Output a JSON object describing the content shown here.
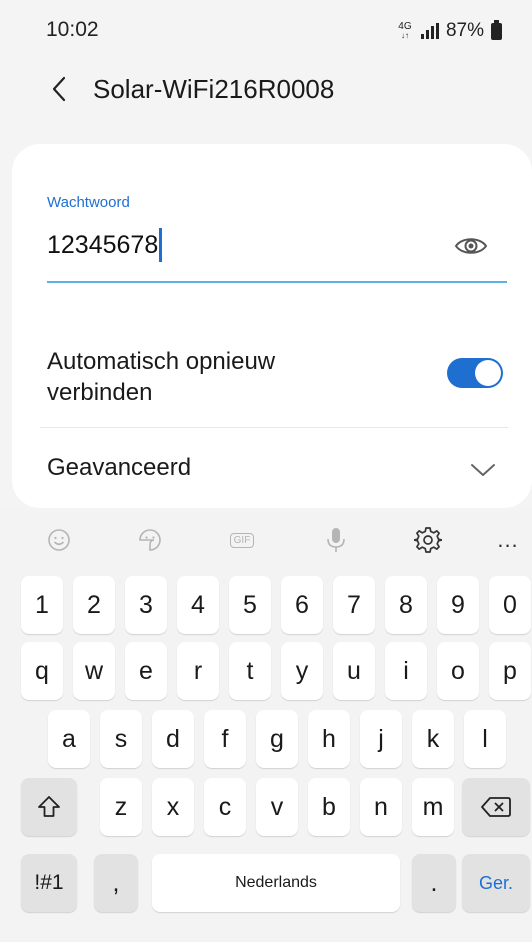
{
  "status": {
    "time": "10:02",
    "network": "4G",
    "battery": "87%"
  },
  "header": {
    "title": "Solar-WiFi216R0008"
  },
  "form": {
    "password_label": "Wachtwoord",
    "password_value": "12345678",
    "auto_reconnect_label_1": "Automatisch opnieuw",
    "auto_reconnect_label_2": "verbinden",
    "auto_reconnect_on": true,
    "advanced_label": "Geavanceerd"
  },
  "keyboard": {
    "toolbar": [
      "emoji-icon",
      "sticker-icon",
      "gif-icon",
      "mic-icon",
      "settings-icon",
      "more-icon"
    ],
    "gif_label": "GIF",
    "more_label": "...",
    "number_row": [
      "1",
      "2",
      "3",
      "4",
      "5",
      "6",
      "7",
      "8",
      "9",
      "0"
    ],
    "row1": [
      "q",
      "w",
      "e",
      "r",
      "t",
      "y",
      "u",
      "i",
      "o",
      "p"
    ],
    "row2": [
      "a",
      "s",
      "d",
      "f",
      "g",
      "h",
      "j",
      "k",
      "l"
    ],
    "row3": [
      "z",
      "x",
      "c",
      "v",
      "b",
      "n",
      "m"
    ],
    "symbols_key": "!#1",
    "comma_key": ",",
    "space_label": "Nederlands",
    "period_key": ".",
    "go_key": "Ger."
  },
  "colors": {
    "accent": "#1f6fd1",
    "underline": "#5ab1ea",
    "background": "#f4f4f4"
  }
}
